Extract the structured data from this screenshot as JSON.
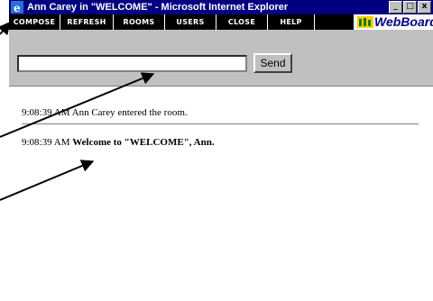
{
  "window": {
    "title": "Ann Carey in \"WELCOME\" - Microsoft Internet Explorer",
    "controls": [
      "_",
      "□",
      "x"
    ]
  },
  "toolbar": {
    "items": [
      "COMPOSE",
      "REFRESH",
      "ROOMS",
      "USERS",
      "CLOSE",
      "HELP"
    ],
    "brand": "WebBoard",
    "brand_suffix": "™"
  },
  "input": {
    "value": "",
    "send_label": "Send"
  },
  "chat": {
    "messages": [
      {
        "time": "9:08:39 AM",
        "text": "Ann Carey entered the room."
      },
      {
        "time": "9:08:39 AM",
        "text": "Welcome to \"WELCOME\", Ann."
      }
    ]
  },
  "colors": {
    "titlebar": "#000080",
    "toolbar": "#000000",
    "chrome": "#c0c0c0",
    "brand": "#000080"
  }
}
